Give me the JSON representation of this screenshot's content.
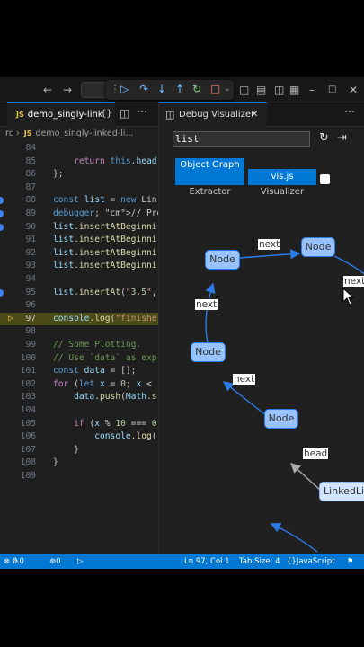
{
  "toolbar": {
    "back_icon": "arrow-left-icon",
    "forward_icon": "arrow-right-icon",
    "debug_controls": [
      "continue",
      "step-over",
      "step-into",
      "step-out",
      "restart",
      "stop"
    ]
  },
  "editor": {
    "tab_label": "demo_singly-link",
    "tab_badge": "JS",
    "split_glyph": "{}",
    "breadcrumb_prefix": "rc",
    "breadcrumb_sep": "›",
    "breadcrumb_file": "demo_singly-linked-li...",
    "lines": [
      {
        "num": "84",
        "text": ""
      },
      {
        "num": "85",
        "text": "    return this.head"
      },
      {
        "num": "86",
        "text": "};"
      },
      {
        "num": "87",
        "text": ""
      },
      {
        "num": "88",
        "text": "const list = new Lin"
      },
      {
        "num": "89",
        "text": "debugger; // Press F"
      },
      {
        "num": "90",
        "text": "list.insertAtBeginni"
      },
      {
        "num": "91",
        "text": "list.insertAtBeginni"
      },
      {
        "num": "92",
        "text": "list.insertAtBeginni"
      },
      {
        "num": "93",
        "text": "list.insertAtBeginni"
      },
      {
        "num": "94",
        "text": ""
      },
      {
        "num": "95",
        "text": "list.insertAt(\"3.5\","
      },
      {
        "num": "96",
        "text": ""
      },
      {
        "num": "97",
        "text": "console.log(\"finishe"
      },
      {
        "num": "98",
        "text": ""
      },
      {
        "num": "99",
        "text": "// Some Plotting."
      },
      {
        "num": "100",
        "text": "// Use `data` as exp"
      },
      {
        "num": "101",
        "text": "const data = [];"
      },
      {
        "num": "102",
        "text": "for (let x = 0; x <"
      },
      {
        "num": "103",
        "text": "    data.push(Math.s"
      },
      {
        "num": "104",
        "text": ""
      },
      {
        "num": "105",
        "text": "    if (x % 10 === 0"
      },
      {
        "num": "106",
        "text": "        console.log("
      },
      {
        "num": "107",
        "text": "    }"
      },
      {
        "num": "108",
        "text": "}"
      },
      {
        "num": "109",
        "text": ""
      }
    ]
  },
  "visualizer": {
    "tab_label": "Debug Visualizer",
    "expression": "list",
    "extractor_button": "Object Graph",
    "extractor_label": "Extractor",
    "visualizer_button": "vis.js",
    "visualizer_label": "Visualizer",
    "nodes": [
      {
        "id": "n1",
        "label": "Node"
      },
      {
        "id": "n2",
        "label": "Node"
      },
      {
        "id": "n3",
        "label": "Node"
      },
      {
        "id": "n4",
        "label": "Node"
      },
      {
        "id": "root",
        "label": "LinkedLi"
      }
    ],
    "edges": [
      {
        "from": "n1",
        "to": "n2",
        "label": "next"
      },
      {
        "from": "n2",
        "to": "n3",
        "label": "next"
      },
      {
        "from": "n3",
        "to": "n4",
        "label": "next"
      },
      {
        "from": "n4",
        "to": "n1",
        "label": "next"
      },
      {
        "from": "root",
        "to": "n3",
        "label": "head"
      }
    ]
  },
  "status": {
    "errors": "0",
    "warnings": "0",
    "ports": "0",
    "position": "Ln 97, Col 1",
    "tab_size": "Tab Size: 4",
    "language": "JavaScript"
  },
  "colors": {
    "accent": "#0078d4",
    "node_fill": "#97c2fc",
    "node_border": "#2b7ce9",
    "current_line": "#4b4b18"
  }
}
